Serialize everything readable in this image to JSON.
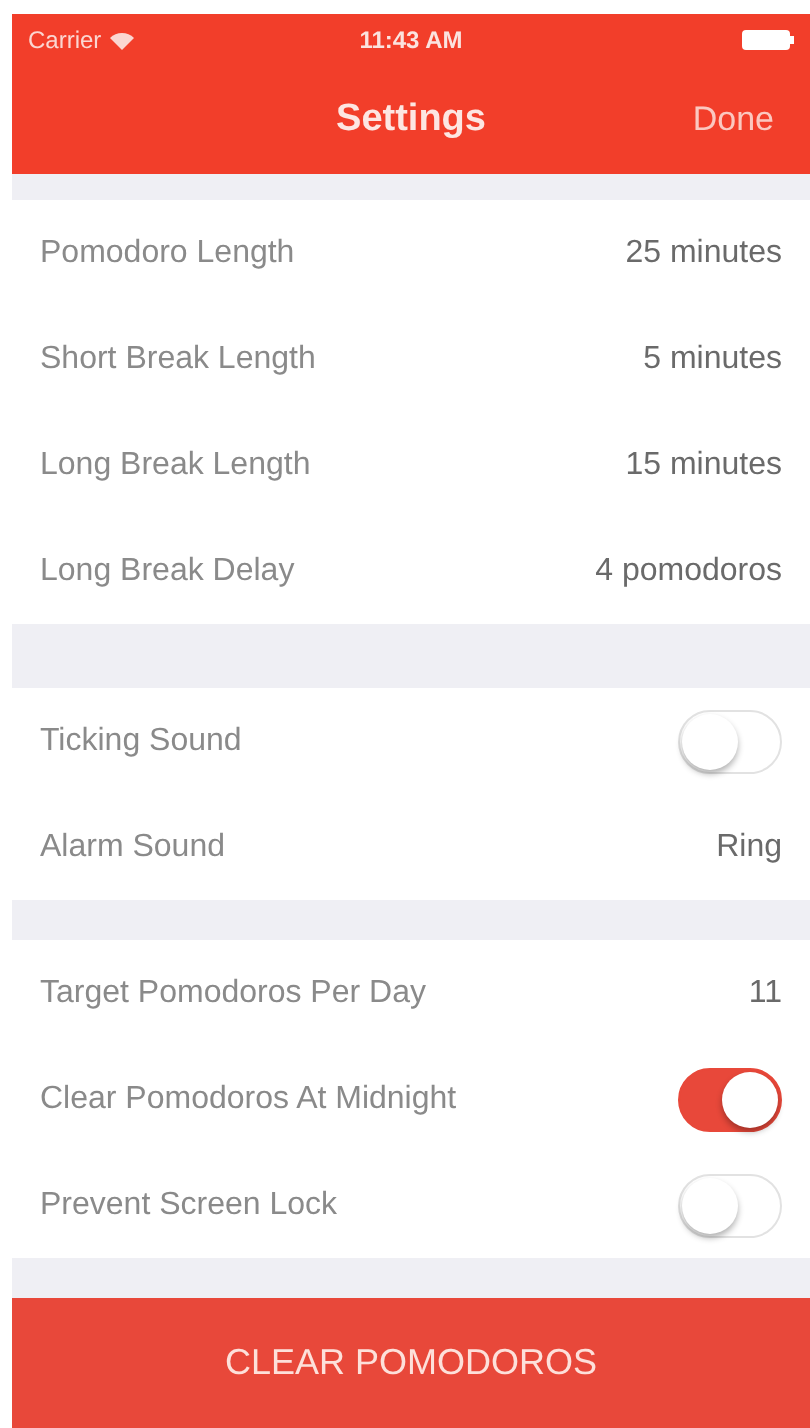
{
  "status_bar": {
    "carrier": "Carrier",
    "time": "11:43 AM"
  },
  "nav_bar": {
    "title": "Settings",
    "done": "Done"
  },
  "sections": [
    {
      "rows": [
        {
          "kind": "value",
          "label": "Pomodoro Length",
          "value": "25 minutes"
        },
        {
          "kind": "value",
          "label": "Short Break Length",
          "value": "5 minutes"
        },
        {
          "kind": "value",
          "label": "Long Break Length",
          "value": "15 minutes"
        },
        {
          "kind": "value",
          "label": "Long Break Delay",
          "value": "4 pomodoros"
        }
      ]
    },
    {
      "rows": [
        {
          "kind": "toggle",
          "label": "Ticking Sound",
          "on": false
        },
        {
          "kind": "value",
          "label": "Alarm Sound",
          "value": "Ring"
        }
      ]
    },
    {
      "rows": [
        {
          "kind": "value",
          "label": "Target Pomodoros Per Day",
          "value": "11"
        },
        {
          "kind": "toggle",
          "label": "Clear Pomodoros At Midnight",
          "on": true
        },
        {
          "kind": "toggle",
          "label": "Prevent Screen Lock",
          "on": false
        }
      ]
    }
  ],
  "clear_button": "CLEAR POMODOROS"
}
